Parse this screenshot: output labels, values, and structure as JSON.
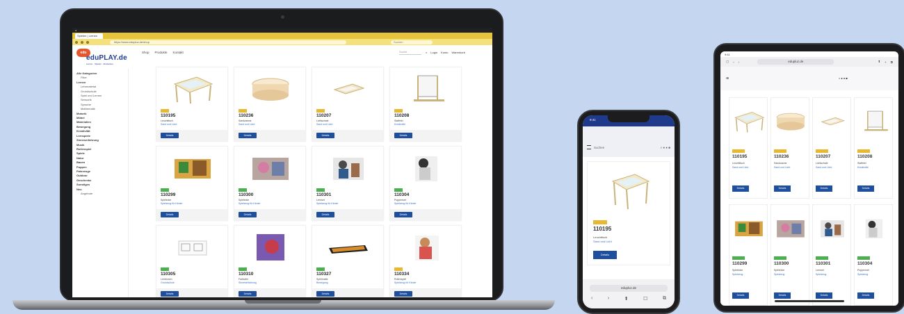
{
  "laptop": {
    "browser_tab": "Spielen | Lernen",
    "url": "https://www.edupluz.de/shop",
    "search_placeholder": "Suchen",
    "logo_badge": "edu",
    "logo_text": "eduPLAY.de",
    "logo_sub": "Lernen · Spielen · Entdecken",
    "topnav": [
      "Shop",
      "Produkte",
      "Kontakt"
    ],
    "topsearch": "Suche",
    "topactions": [
      "Login",
      "Konto",
      "Warenkorb"
    ],
    "sidebar": [
      {
        "label": "Alle Kategorien",
        "style": "bold"
      },
      {
        "label": "Filter",
        "style": "ind"
      },
      {
        "label": "Lernen",
        "style": "bold"
      },
      {
        "label": "Lehrmaterial",
        "style": "ind"
      },
      {
        "label": "Grundschule",
        "style": "ind"
      },
      {
        "label": "Spiel und Lernen",
        "style": "ind"
      },
      {
        "label": "Sensorik",
        "style": "ind"
      },
      {
        "label": "Sprache",
        "style": "ind"
      },
      {
        "label": "Mathematik",
        "style": "ind"
      },
      {
        "label": "Motorik",
        "style": "bold"
      },
      {
        "label": "Möbel",
        "style": "bold"
      },
      {
        "label": "Materialien",
        "style": "bold"
      },
      {
        "label": "Bewegung",
        "style": "bold"
      },
      {
        "label": "Kreativität",
        "style": "bold"
      },
      {
        "label": "Lernspiele",
        "style": "bold"
      },
      {
        "label": "Sinneserfahrung",
        "style": "bold"
      },
      {
        "label": "Musik",
        "style": "bold"
      },
      {
        "label": "Rollenspiel",
        "style": "bold"
      },
      {
        "label": "Spiele",
        "style": "bold"
      },
      {
        "label": "Natur",
        "style": "bold"
      },
      {
        "label": "Bauen",
        "style": "bold"
      },
      {
        "label": "Puppen",
        "style": "bold"
      },
      {
        "label": "Fahrzeuge",
        "style": "bold"
      },
      {
        "label": "Outdoor",
        "style": "bold"
      },
      {
        "label": "Geschenke",
        "style": "bold"
      },
      {
        "label": "Sonstiges",
        "style": "bold"
      },
      {
        "label": "Neu",
        "style": "bold"
      },
      {
        "label": "Angebote",
        "style": "ind"
      }
    ],
    "products": [
      {
        "code": "110195",
        "badge": "y",
        "pic": "table",
        "l1": "Leuchttisch",
        "l2": "Sand und Licht"
      },
      {
        "code": "110236",
        "badge": "y",
        "pic": "drum",
        "l1": "Sandwanne",
        "l2": "Sand und Licht"
      },
      {
        "code": "110207",
        "badge": "y",
        "pic": "tray",
        "l1": "Lichtschale",
        "l2": "Sand und Licht"
      },
      {
        "code": "110208",
        "badge": "y",
        "pic": "easel",
        "l1": "Staffelei",
        "l2": "Kreativität"
      },
      {
        "code": "110299",
        "badge": "g",
        "pic": "photo1",
        "l1": "Spielecke",
        "l2": "Spielzeug für Kinder"
      },
      {
        "code": "110300",
        "badge": "g",
        "pic": "photo2",
        "l1": "Spielecke",
        "l2": "Spielzeug für Kinder"
      },
      {
        "code": "110301",
        "badge": "g",
        "pic": "photo3",
        "l1": "Lernset",
        "l2": "Spielzeug für Kinder"
      },
      {
        "code": "110304",
        "badge": "g",
        "pic": "photo4",
        "l1": "Puppenset",
        "l2": "Spielzeug für Kinder"
      },
      {
        "code": "110305",
        "badge": "g",
        "pic": "boxes",
        "l1": "Lernboxen",
        "l2": "Grundschule"
      },
      {
        "code": "110310",
        "badge": "g",
        "pic": "purple",
        "l1": "Farbtafel",
        "l2": "Sinneserfahrung"
      },
      {
        "code": "110327",
        "badge": "g",
        "pic": "mat",
        "l1": "Spielmatte",
        "l2": "Bewegung"
      },
      {
        "code": "110334",
        "badge": "y",
        "pic": "photo5",
        "l1": "Rollenspiel",
        "l2": "Spielzeug für Kinder"
      }
    ],
    "button_label": "Details"
  },
  "phone": {
    "time": "9:41",
    "search_placeholder": "Suchen",
    "product": {
      "code": "110195",
      "l1": "Leuchttisch",
      "l2": "Sand und Licht",
      "button": "Details"
    },
    "url": "edupluz.de",
    "bottom_icons": [
      "‹",
      "›",
      "⬆",
      "☐",
      "⧉"
    ]
  },
  "tablet": {
    "time": "9:41",
    "url": "edupluz.de",
    "products": [
      {
        "code": "110195",
        "badge": "y",
        "pic": "table",
        "l1": "Leuchttisch",
        "l2": "Sand und Licht"
      },
      {
        "code": "110236",
        "badge": "y",
        "pic": "drum",
        "l1": "Sandwanne",
        "l2": "Sand und Licht"
      },
      {
        "code": "110207",
        "badge": "y",
        "pic": "tray",
        "l1": "Lichtschale",
        "l2": "Sand und Licht"
      },
      {
        "code": "110208",
        "badge": "y",
        "pic": "easel",
        "l1": "Staffelei",
        "l2": "Kreativität"
      },
      {
        "code": "110299",
        "badge": "g",
        "pic": "photo1",
        "l1": "Spielecke",
        "l2": "Spielzeug"
      },
      {
        "code": "110300",
        "badge": "g",
        "pic": "photo2",
        "l1": "Spielecke",
        "l2": "Spielzeug"
      },
      {
        "code": "110301",
        "badge": "g",
        "pic": "photo3",
        "l1": "Lernset",
        "l2": "Spielzeug"
      },
      {
        "code": "110304",
        "badge": "g",
        "pic": "photo4",
        "l1": "Puppenset",
        "l2": "Spielzeug"
      }
    ],
    "button_label": "Details"
  },
  "colors": {
    "accent": "#1d4f9e",
    "yellow_badge": "#e8b830",
    "green_badge": "#4caf50",
    "background": "#c5d7f0"
  }
}
